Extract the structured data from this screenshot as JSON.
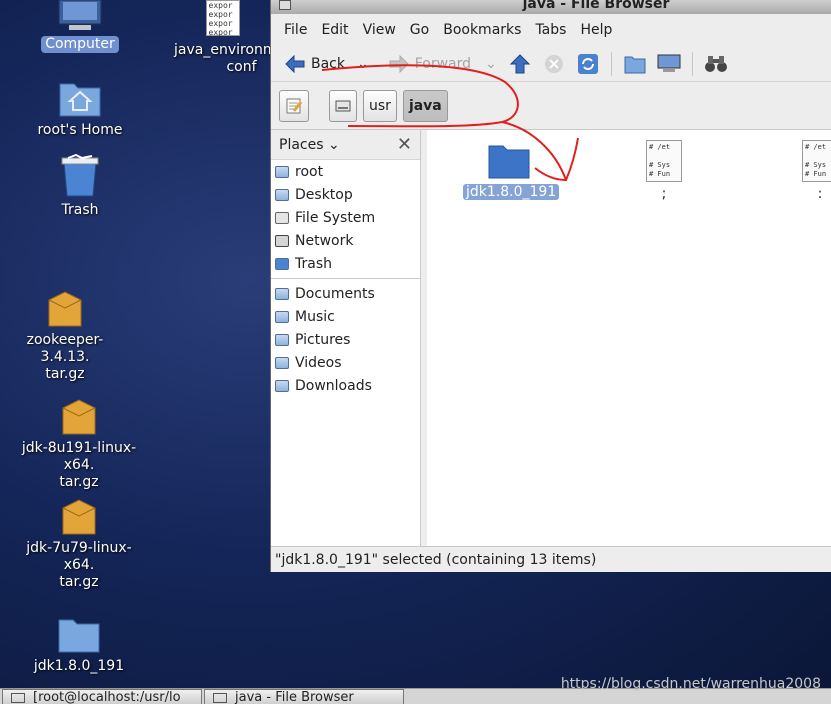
{
  "desktop": {
    "icons": [
      {
        "label": "Computer"
      },
      {
        "label": "java_environm",
        "label2": "conf"
      },
      {
        "label": "root's Home"
      },
      {
        "label": "Trash"
      },
      {
        "label": "zookeeper-3.4.13.",
        "label2": "tar.gz"
      },
      {
        "label": "jdk-8u191-linux-x64.",
        "label2": "tar.gz"
      },
      {
        "label": "jdk-7u79-linux-x64.",
        "label2": "tar.gz"
      },
      {
        "label": "jdk1.8.0_191"
      }
    ],
    "java_env_preview": [
      "expor",
      "expor",
      "expor",
      "expor"
    ]
  },
  "window": {
    "title": "java - File Browser",
    "menu": [
      "File",
      "Edit",
      "View",
      "Go",
      "Bookmarks",
      "Tabs",
      "Help"
    ],
    "toolbar": {
      "back": "Back",
      "forward": "Forward"
    },
    "path": [
      "usr",
      "java"
    ]
  },
  "sidebar": {
    "header": "Places",
    "places": [
      "root",
      "Desktop",
      "File System",
      "Network",
      "Trash"
    ],
    "bookmarks": [
      "Documents",
      "Music",
      "Pictures",
      "Videos",
      "Downloads"
    ]
  },
  "files": [
    {
      "name": "jdk1.8.0_191"
    },
    {
      "name": ";",
      "preview": [
        "# /et",
        "",
        "# Sys",
        "# Fun"
      ]
    },
    {
      "name": ":",
      "preview": [
        "# /et",
        "",
        "# Sys",
        "# Fun"
      ]
    }
  ],
  "status": "\"jdk1.8.0_191\" selected (containing 13 items)",
  "taskbar": [
    "[root@localhost:/usr/lo",
    "java - File Browser"
  ],
  "watermark": "https://blog.csdn.net/warrenhua2008",
  "colors": {
    "selection": "#6f8fd0",
    "annotation": "#e0201a"
  }
}
